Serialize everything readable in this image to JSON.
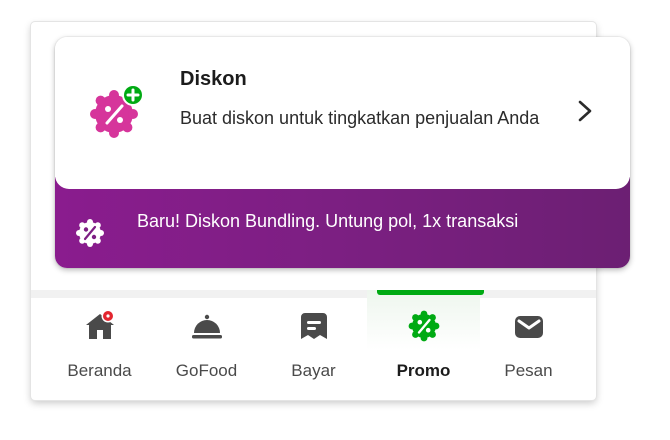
{
  "card": {
    "title": "Diskon",
    "description": "Buat diskon untuk tingkatkan penjualan Anda",
    "icon": "discount-badge-plus-icon",
    "banner_text": "Baru! Diskon Bundling. Untung pol, 1x transaksi",
    "banner_icon": "percent-badge-icon"
  },
  "nav": {
    "items": [
      {
        "label": "Beranda",
        "icon": "home-icon",
        "has_notification": true
      },
      {
        "label": "GoFood",
        "icon": "food-cloche-icon"
      },
      {
        "label": "Bayar",
        "icon": "payment-icon"
      },
      {
        "label": "Promo",
        "icon": "promo-badge-icon",
        "active": true
      },
      {
        "label": "Pesan",
        "icon": "mail-icon"
      }
    ]
  },
  "colors": {
    "accent_green": "#00aa13",
    "banner_purple": "#7d1f83",
    "discount_pink": "#d6359b",
    "notification_red": "#e3262f"
  }
}
